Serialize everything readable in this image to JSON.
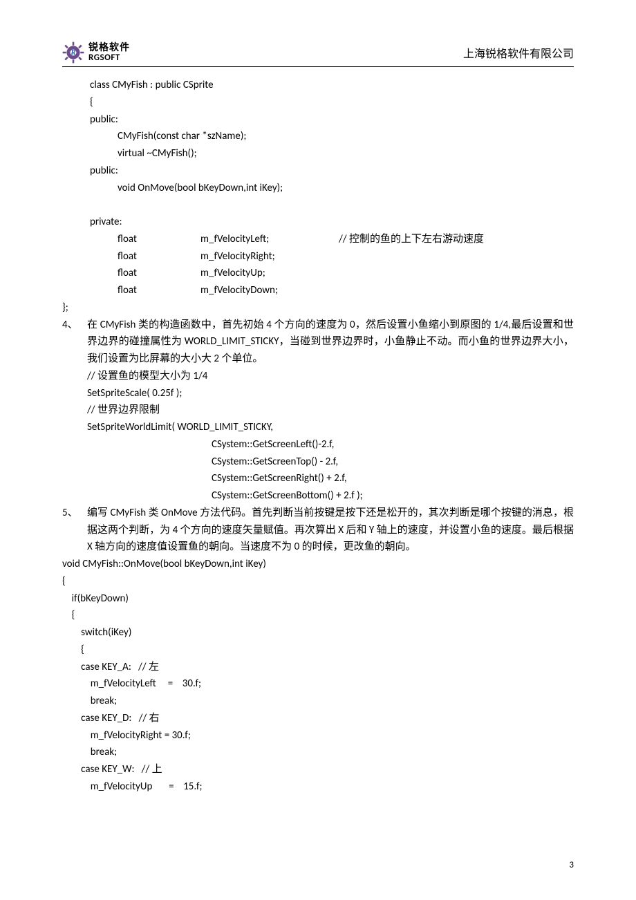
{
  "header": {
    "logo_cn": "锐格软件",
    "logo_en": "RGSOFT",
    "company": "上海锐格软件有限公司"
  },
  "code1": {
    "l1": "class CMyFish : public CSprite",
    "l2": "{",
    "l3": "public:",
    "l4": "CMyFish(const char *szName);",
    "l5": "virtual ~CMyFish();",
    "l6": "public:",
    "l7": "void OnMove(bool bKeyDown,int iKey);",
    "l8": "private:",
    "l9a": "float",
    "l9b": "m_fVelocityLeft;",
    "l9c": "// 控制的鱼的上下左右游动速度",
    "l10a": "float",
    "l10b": "m_fVelocityRight;",
    "l11a": "float",
    "l11b": "m_fVelocityUp;",
    "l12a": "float",
    "l12b": "m_fVelocityDown;",
    "l13": "};"
  },
  "item4": {
    "label": "4、",
    "text": "在 CMyFish 类的构造函数中，首先初始 4 个方向的速度为 0，然后设置小鱼缩小到原图的 1/4,最后设置和世界边界的碰撞属性为 WORLD_LIMIT_STICKY，当碰到世界边界时，小鱼静止不动。而小鱼的世界边界大小，我们设置为比屏幕的大小大 2 个单位。",
    "c1": "// 设置鱼的模型大小为 1/4",
    "c2": "SetSpriteScale( 0.25f );",
    "c3": "// 世界边界限制",
    "c4": "SetSpriteWorldLimit( WORLD_LIMIT_STICKY,",
    "c5": "CSystem::GetScreenLeft()-2.f,",
    "c6": "CSystem::GetScreenTop() - 2.f,",
    "c7": "CSystem::GetScreenRight() + 2.f,",
    "c8": "CSystem::GetScreenBottom() + 2.f );"
  },
  "item5": {
    "label": "5、",
    "text": "编写 CMyFish 类 OnMove 方法代码。首先判断当前按键是按下还是松开的，其次判断是哪个按键的消息，根据这两个判断，为 4 个方向的速度矢量赋值。再次算出 X 后和 Y 轴上的速度，并设置小鱼的速度。最后根据 X 轴方向的速度值设置鱼的朝向。当速度不为 0 的时候，更改鱼的朝向。"
  },
  "code2": "void CMyFish::OnMove(bool bKeyDown,int iKey)\n{\n    if(bKeyDown)\n    {\n        switch(iKey)\n        {\n        case KEY_A:   // 左\n            m_fVelocityLeft     =    30.f;\n            break;\n        case KEY_D:   // 右\n            m_fVelocityRight = 30.f;\n            break;\n        case KEY_W:   // 上\n            m_fVelocityUp       =    15.f;",
  "page_number": "3"
}
